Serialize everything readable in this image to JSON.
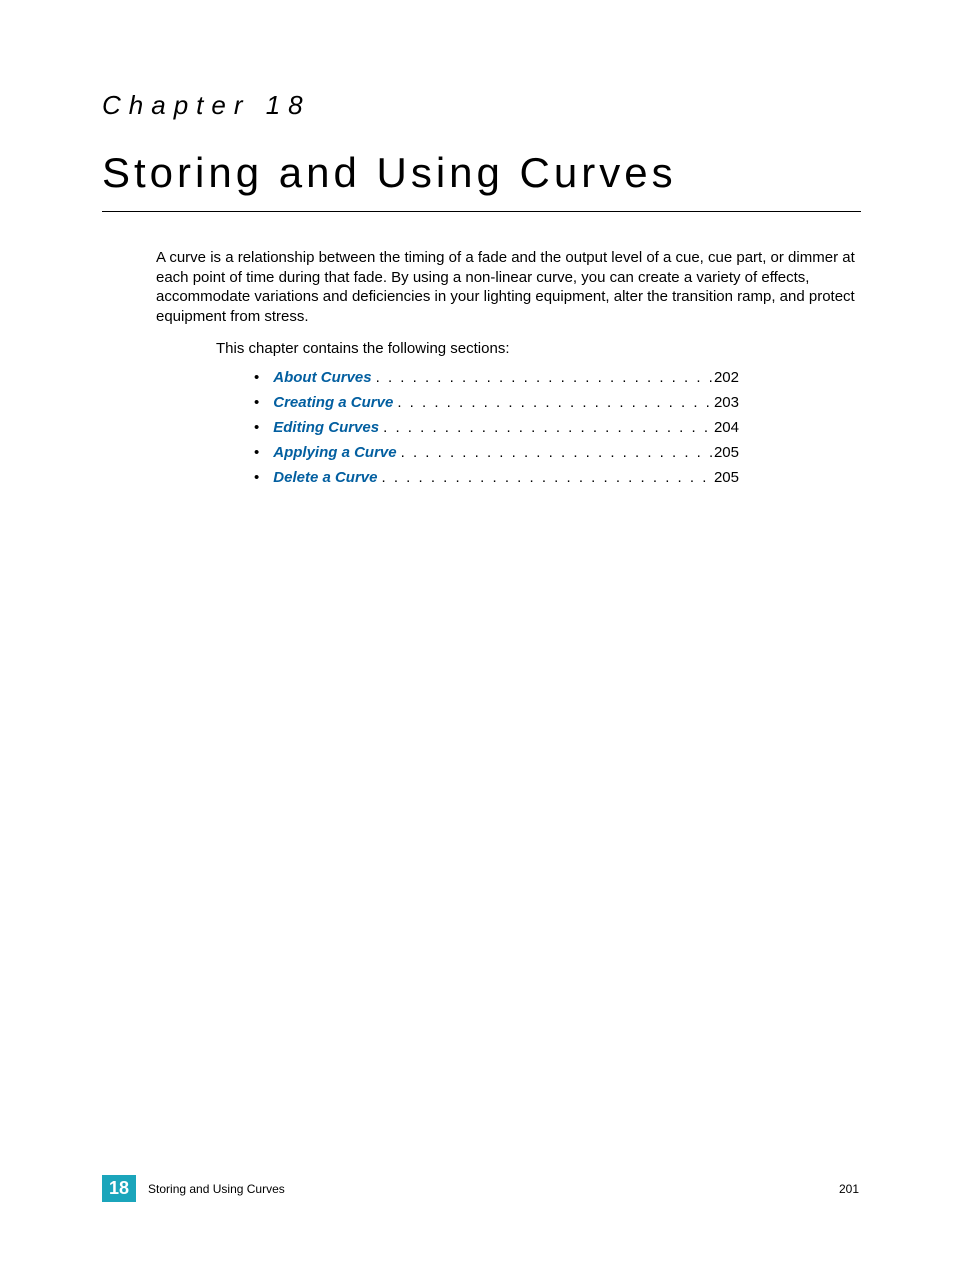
{
  "chapter": {
    "label": "Chapter 18",
    "title": "Storing and Using Curves",
    "number": "18"
  },
  "intro": "A curve is a relationship between the timing of a fade and the output level of a cue, cue part, or dimmer at each point of time during that fade. By using a non-linear curve, you can create a variety of effects, accommodate variations and deficiencies in your lighting equipment, alter the transition ramp, and protect equipment from stress.",
  "sections_intro": "This chapter contains the following sections:",
  "toc": [
    {
      "label": "About Curves",
      "page": "202"
    },
    {
      "label": "Creating a Curve",
      "page": "203"
    },
    {
      "label": "Editing Curves",
      "page": "204"
    },
    {
      "label": "Applying a Curve",
      "page": "205"
    },
    {
      "label": "Delete a Curve",
      "page": "205"
    }
  ],
  "footer": {
    "title": "Storing and Using Curves",
    "page": "201"
  }
}
